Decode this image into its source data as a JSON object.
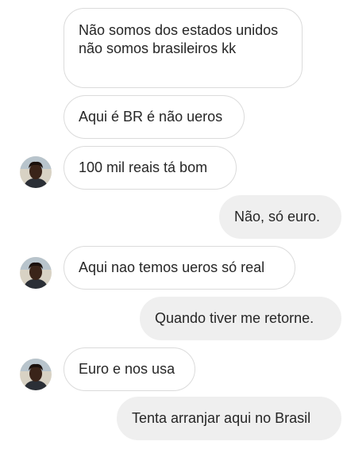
{
  "messages": [
    {
      "side": "received",
      "text": "Não somos dos estados unidos não somos brasileiros kk"
    },
    {
      "side": "received",
      "text": "Aqui é BR é não ueros"
    },
    {
      "side": "received",
      "text": "100 mil reais tá bom"
    },
    {
      "side": "sent",
      "text": "Não, só euro."
    },
    {
      "side": "received",
      "text": "Aqui nao temos ueros só real"
    },
    {
      "side": "sent",
      "text": "Quando tiver me retorne."
    },
    {
      "side": "received",
      "text": "Euro e nos usa"
    },
    {
      "side": "sent",
      "text": "Tenta arranjar aqui no Brasil"
    }
  ],
  "colors": {
    "received_bubble_bg": "#ffffff",
    "received_bubble_border": "#dbdbdb",
    "sent_bubble_bg": "#efefef",
    "text": "#262626"
  },
  "icons": {
    "avatar": "contact-avatar"
  }
}
